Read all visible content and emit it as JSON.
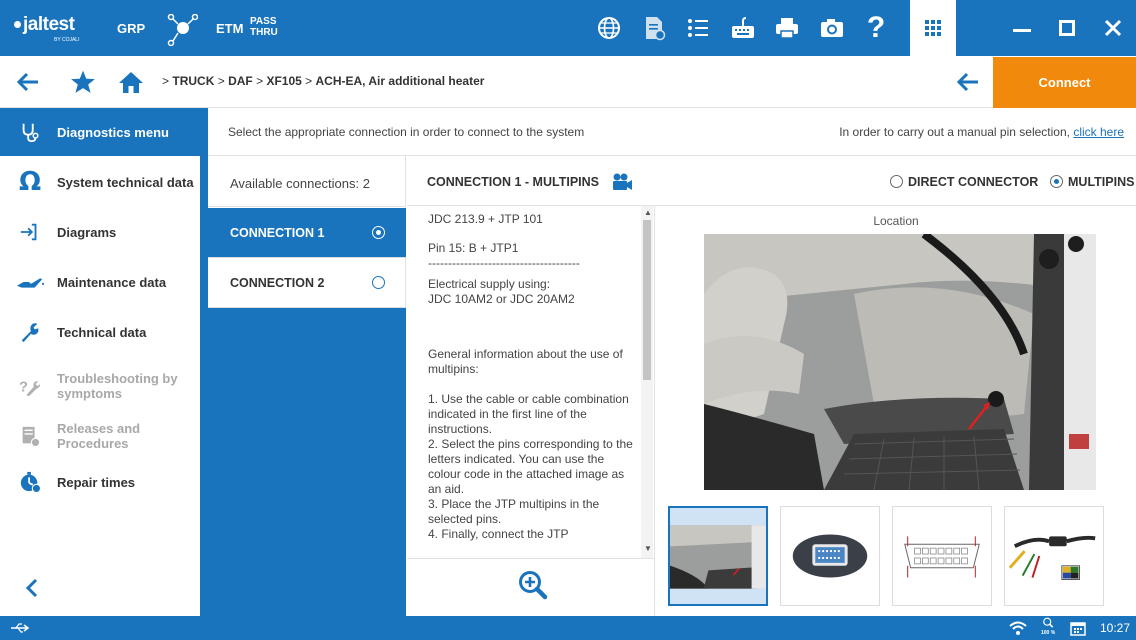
{
  "topbar": {
    "brand": "jaltest",
    "brand_sub": "BY COJALI",
    "grp": "GRP",
    "etm": "ETM",
    "pass": "PASS",
    "thru": "THRU",
    "tools": [
      "globe-icon",
      "report-icon",
      "list-icon",
      "keyboard-icon",
      "printer-icon",
      "camera-icon",
      "help-icon",
      "apps-icon"
    ],
    "window_controls": [
      "minimize-icon",
      "maximize-icon",
      "close-icon"
    ]
  },
  "breadcrumb": {
    "items": [
      "TRUCK",
      "DAF",
      "XF105",
      "ACH-EA, Air additional heater"
    ],
    "separator": ">"
  },
  "connect_label": "Connect",
  "sidebar": {
    "items": [
      {
        "label": "Diagnostics menu",
        "icon": "stethoscope-icon",
        "active": true,
        "enabled": true
      },
      {
        "label": "System technical data",
        "icon": "omega-icon",
        "active": false,
        "enabled": true
      },
      {
        "label": "Diagrams",
        "icon": "diagram-icon",
        "active": false,
        "enabled": true
      },
      {
        "label": "Maintenance data",
        "icon": "oil-can-icon",
        "active": false,
        "enabled": true
      },
      {
        "label": "Technical data",
        "icon": "wrench-icon",
        "active": false,
        "enabled": true
      },
      {
        "label": "Troubleshooting by symptoms",
        "icon": "troubleshoot-icon",
        "active": false,
        "enabled": false
      },
      {
        "label": "Releases and Procedures",
        "icon": "releases-icon",
        "active": false,
        "enabled": false
      },
      {
        "label": "Repair times",
        "icon": "stopwatch-icon",
        "active": false,
        "enabled": true
      }
    ]
  },
  "instruction": {
    "text": "Select the appropriate connection in order to connect to the system",
    "manual_text": "In order to carry out a manual pin selection, ",
    "manual_link": "click here"
  },
  "connections": {
    "available_label": "Available connections: 2",
    "items": [
      {
        "label": "CONNECTION 1",
        "selected": true
      },
      {
        "label": "CONNECTION 2",
        "selected": false
      }
    ]
  },
  "connection_detail": {
    "title": "CONNECTION 1 - MULTIPINS",
    "options": [
      {
        "label": "DIRECT CONNECTOR",
        "selected": false
      },
      {
        "label": "MULTIPINS",
        "selected": true
      }
    ],
    "text_blocks": [
      "JDC 213.9 + JTP 101",
      "Pin 15: B + JTP1\n--------------------------------------",
      "Electrical supply using:\nJDC 10AM2  or  JDC 20AM2",
      "",
      "General information about the use of multipins:",
      "1. Use the cable or cable combination indicated in the first line of the instructions.\n2. Select the pins corresponding to the letters indicated. You can use the colour code in the attached image as an aid.\n3. Place the JTP multipins in the selected pins.\n4. Finally, connect the JTP"
    ],
    "location_label": "Location"
  },
  "status": {
    "clock": "10:27",
    "zoom": "100 %"
  },
  "colors": {
    "primary": "#1a74bd",
    "accent": "#f0890c"
  }
}
